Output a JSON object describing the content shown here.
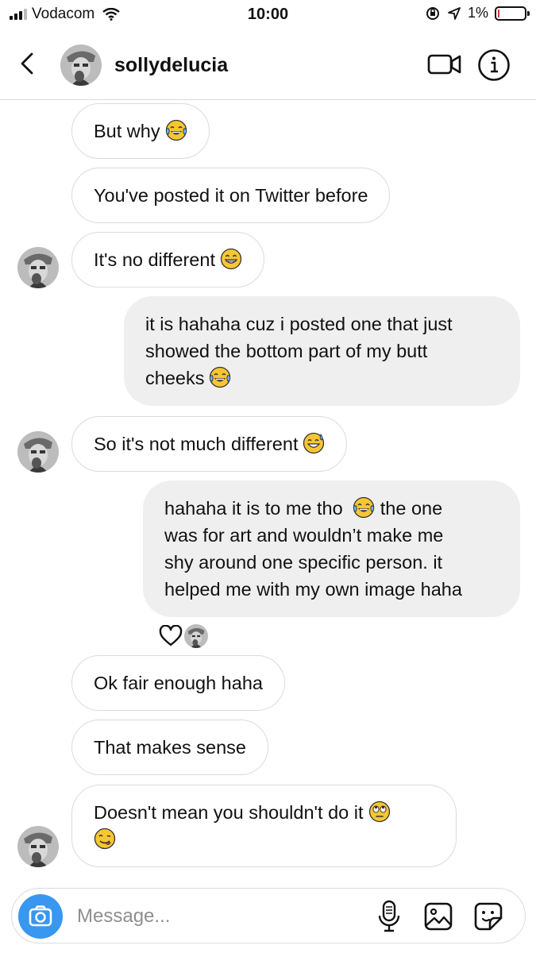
{
  "status_bar": {
    "carrier": "Vodacom",
    "time": "10:00",
    "battery": "1%"
  },
  "header": {
    "username": "sollydelucia"
  },
  "messages": [
    {
      "direction": "in",
      "text": "But why",
      "emoji": "tears-of-joy-emoji"
    },
    {
      "direction": "in",
      "text": "You've posted it on Twitter before"
    },
    {
      "direction": "in",
      "text": "It's no different",
      "emoji": "grinning-emoji"
    },
    {
      "direction": "out",
      "lines": [
        "it is hahaha cuz i posted one that just",
        "showed the bottom part of my butt",
        "cheeks"
      ],
      "emoji": "tears-of-joy-emoji"
    },
    {
      "direction": "in",
      "text": "So it's not much different",
      "emoji": "sweat-smile-emoji"
    },
    {
      "direction": "out",
      "line1_a": "hahaha it is to me tho",
      "line1_b": "the one",
      "lines": [
        "was for art and wouldn’t make me",
        "shy around one specific person. it",
        "helped me with my own image haha"
      ],
      "emoji": "tears-of-joy-emoji"
    },
    {
      "direction": "in",
      "text": "Ok fair enough haha"
    },
    {
      "direction": "in",
      "text": "That makes sense"
    },
    {
      "direction": "in",
      "text": "Doesn't mean you shouldn't do it",
      "emoji": "eye-roll-emoji",
      "emoji2": "yum-emoji"
    }
  ],
  "composer": {
    "placeholder": "Message..."
  },
  "colors": {
    "accent": "#3897f0",
    "bubble_out": "#efefef",
    "border": "#dbdbdb",
    "emoji_yellow": "#f7c631"
  }
}
